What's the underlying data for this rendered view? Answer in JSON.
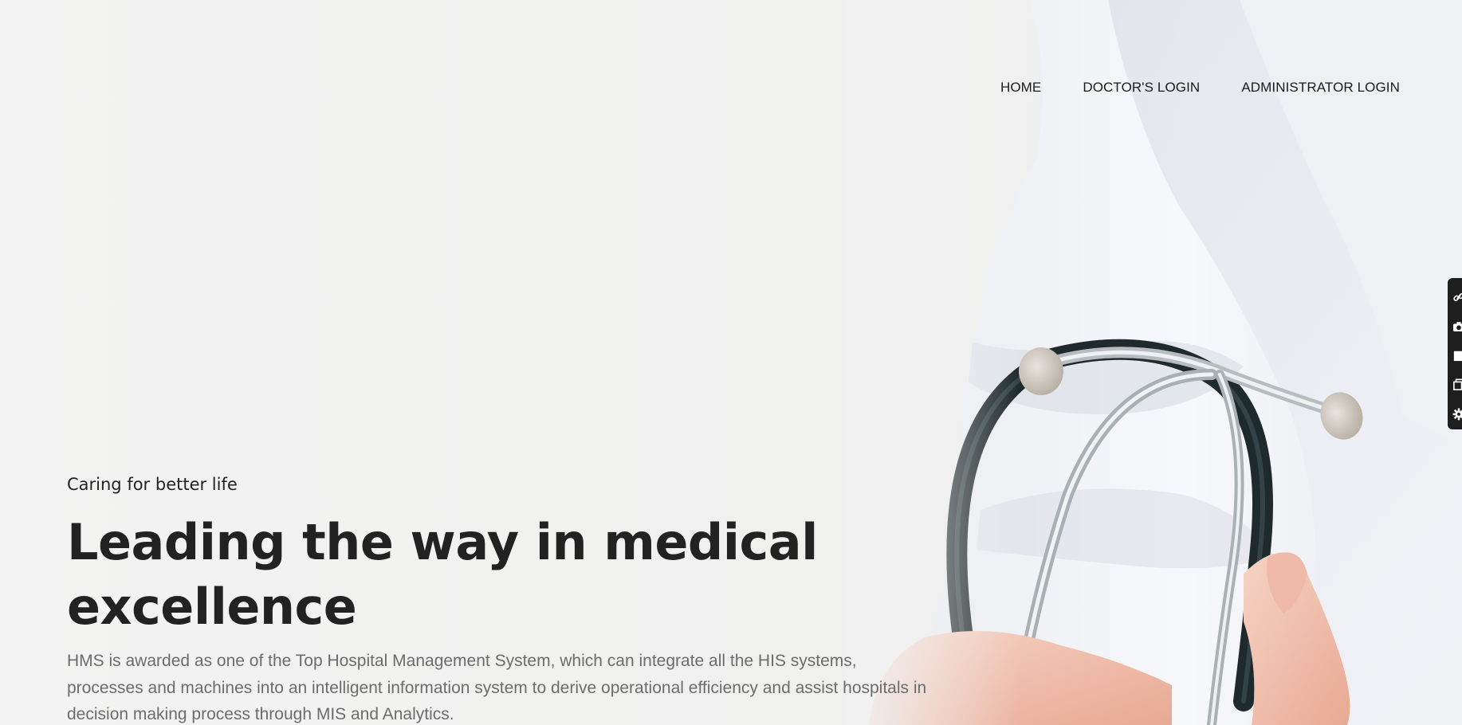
{
  "nav": {
    "items": [
      {
        "label": "HOME"
      },
      {
        "label": "DOCTOR'S LOGIN"
      },
      {
        "label": "ADMINISTRATOR LOGIN"
      }
    ]
  },
  "hero": {
    "tagline": "Caring for better life",
    "headline": "Leading the way in medical excellence",
    "description": "HMS is awarded as one of the Top Hospital Management System, which can integrate all the HIS systems, processes and machines into an intelligent information system to derive operational efficiency and assist hospitals in decision making process through MIS and Analytics."
  },
  "side_toolbar": {
    "icons": [
      "link-icon",
      "camera-icon",
      "square-icon",
      "copy-icon",
      "gear-icon"
    ]
  },
  "colors": {
    "background": "#f1f1f1",
    "headline": "#222222",
    "description": "#6c6c6c",
    "toolbar": "#1e1e1e"
  }
}
